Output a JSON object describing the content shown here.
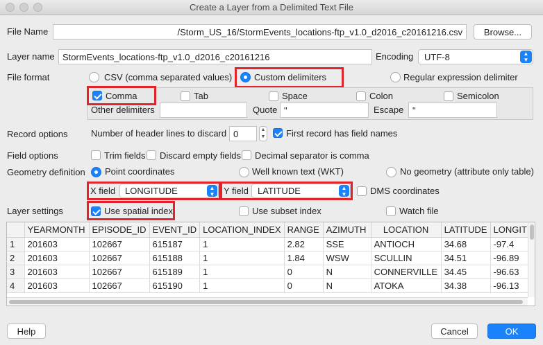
{
  "window": {
    "title": "Create a Layer from a Delimited Text File"
  },
  "file": {
    "label": "File Name",
    "value": "/Storm_US_16/StormEvents_locations-ftp_v1.0_d2016_c20161216.csv",
    "browse_label": "Browse..."
  },
  "layer": {
    "label": "Layer name",
    "value": "StormEvents_locations-ftp_v1.0_d2016_c20161216",
    "encoding_label": "Encoding",
    "encoding_value": "UTF-8"
  },
  "format": {
    "label": "File format",
    "csv": "CSV (comma separated values)",
    "custom": "Custom delimiters",
    "regex": "Regular expression delimiter",
    "selected": "custom"
  },
  "delimiters": {
    "comma": "Comma",
    "comma_checked": true,
    "tab": "Tab",
    "tab_checked": false,
    "space": "Space",
    "space_checked": false,
    "colon": "Colon",
    "colon_checked": false,
    "semicolon": "Semicolon",
    "semicolon_checked": false,
    "other_label": "Other delimiters",
    "other_value": "",
    "quote_label": "Quote",
    "quote_value": "\"",
    "escape_label": "Escape",
    "escape_value": "\""
  },
  "records": {
    "label": "Record options",
    "header_lines_label": "Number of header lines to discard",
    "header_lines_value": "0",
    "first_record_label": "First record has field names",
    "first_record_checked": true
  },
  "field_options": {
    "label": "Field options",
    "trim": "Trim fields",
    "discard_empty": "Discard empty fields",
    "decimal_comma": "Decimal separator is comma"
  },
  "geometry": {
    "label": "Geometry definition",
    "point": "Point coordinates",
    "wkt": "Well known text (WKT)",
    "none": "No geometry (attribute only table)",
    "selected": "point",
    "x_label": "X field",
    "x_value": "LONGITUDE",
    "y_label": "Y field",
    "y_value": "LATITUDE",
    "dms": "DMS coordinates"
  },
  "layer_settings": {
    "label": "Layer settings",
    "spatial_index": "Use spatial index",
    "spatial_index_checked": true,
    "subset_index": "Use subset index",
    "watch_file": "Watch file"
  },
  "table": {
    "columns": [
      "",
      "YEARMONTH",
      "EPISODE_ID",
      "EVENT_ID",
      "LOCATION_INDEX",
      "RANGE",
      "AZIMUTH",
      "LOCATION",
      "LATITUDE",
      "LONGIT"
    ],
    "rows": [
      [
        "1",
        "201603",
        "102667",
        "615187",
        "1",
        "2.82",
        "SSE",
        "ANTIOCH",
        "34.68",
        "-97.4"
      ],
      [
        "2",
        "201603",
        "102667",
        "615188",
        "1",
        "1.84",
        "WSW",
        "SCULLIN",
        "34.51",
        "-96.89"
      ],
      [
        "3",
        "201603",
        "102667",
        "615189",
        "1",
        "0",
        "N",
        "CONNERVILLE",
        "34.45",
        "-96.63"
      ],
      [
        "4",
        "201603",
        "102667",
        "615190",
        "1",
        "0",
        "N",
        "ATOKA",
        "34.38",
        "-96.13"
      ]
    ]
  },
  "footer": {
    "help": "Help",
    "cancel": "Cancel",
    "ok": "OK"
  },
  "colors": {
    "accent": "#1a82fb",
    "highlight": "#e0242b"
  }
}
